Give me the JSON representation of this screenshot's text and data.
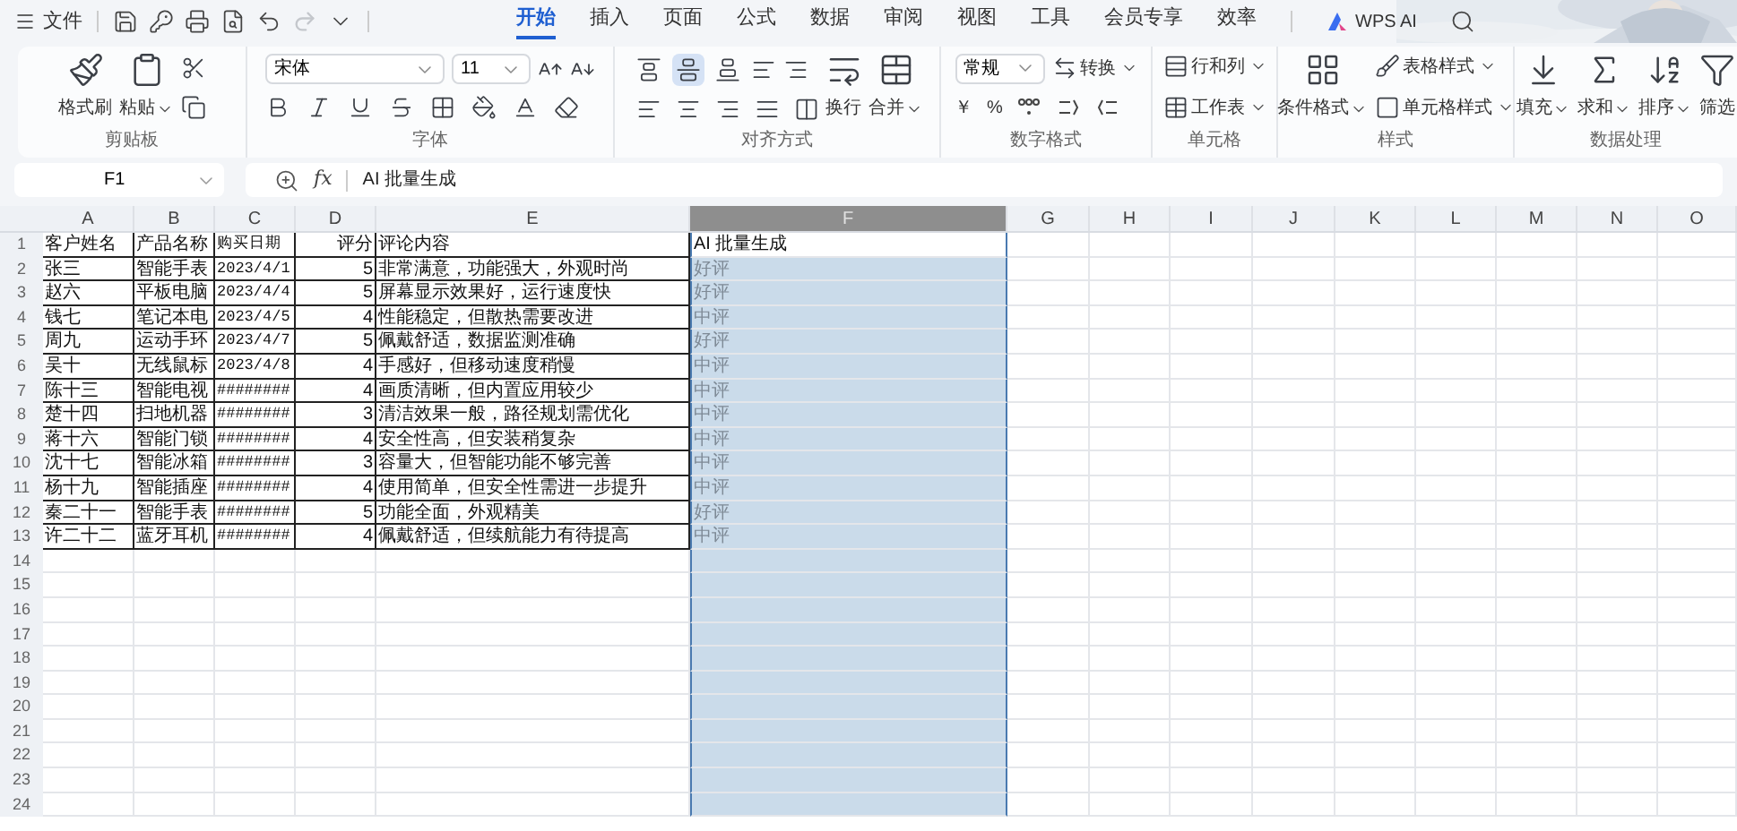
{
  "menu": {
    "file": "文件",
    "redo_disabled": true
  },
  "tabs": [
    {
      "label": "开始",
      "selected": true
    },
    {
      "label": "插入",
      "selected": false
    },
    {
      "label": "页面",
      "selected": false
    },
    {
      "label": "公式",
      "selected": false
    },
    {
      "label": "数据",
      "selected": false
    },
    {
      "label": "审阅",
      "selected": false
    },
    {
      "label": "视图",
      "selected": false
    },
    {
      "label": "工具",
      "selected": false
    },
    {
      "label": "会员专享",
      "selected": false
    },
    {
      "label": "效率",
      "selected": false
    }
  ],
  "ai_tab": "WPS AI",
  "ribbon": {
    "clipboard": {
      "label": "剪贴板",
      "format_painter": "格式刷",
      "paste": "粘贴"
    },
    "font": {
      "label": "字体",
      "font_name": "宋体",
      "font_size": "11"
    },
    "alignment": {
      "label": "对齐方式",
      "wrap": "换行",
      "merge": "合并",
      "vertical_align": [
        {
          "selected": false
        },
        {
          "selected": true
        },
        {
          "selected": false
        }
      ]
    },
    "number_format": {
      "label": "数字格式",
      "format": "常规",
      "convert": "转换",
      "currency": "￥",
      "percent": "%"
    },
    "cells": {
      "label": "单元格",
      "rows_cols": "行和列",
      "worksheet": "工作表"
    },
    "styles": {
      "label": "样式",
      "conditional": "条件格式",
      "table_style": "表格样式",
      "cell_style": "单元格样式"
    },
    "data": {
      "label": "数据处理",
      "fill": "填充",
      "sum": "求和",
      "sort": "排序",
      "filter": "筛选"
    }
  },
  "formula_bar": {
    "name_box": "F1",
    "fx": "fx",
    "formula": "AI 批量生成"
  },
  "columns": [
    {
      "label": "A",
      "selected": false,
      "numeric": false
    },
    {
      "label": "B",
      "selected": false,
      "numeric": false
    },
    {
      "label": "C",
      "selected": false,
      "numeric": false
    },
    {
      "label": "D",
      "selected": false,
      "numeric": true
    },
    {
      "label": "E",
      "selected": false,
      "numeric": false
    },
    {
      "label": "F",
      "selected": true,
      "numeric": false
    },
    {
      "label": "G",
      "selected": false,
      "numeric": false
    },
    {
      "label": "H",
      "selected": false,
      "numeric": false
    },
    {
      "label": "I",
      "selected": false,
      "numeric": false
    },
    {
      "label": "J",
      "selected": false,
      "numeric": false
    },
    {
      "label": "K",
      "selected": false,
      "numeric": false
    },
    {
      "label": "L",
      "selected": false,
      "numeric": false
    },
    {
      "label": "M",
      "selected": false,
      "numeric": false
    },
    {
      "label": "N",
      "selected": false,
      "numeric": false
    },
    {
      "label": "O",
      "selected": false,
      "numeric": false
    }
  ],
  "row_numbers": [
    "1",
    "2",
    "3",
    "4",
    "5",
    "6",
    "7",
    "8",
    "9",
    "10",
    "11",
    "12",
    "13",
    "14",
    "15",
    "16",
    "17",
    "18",
    "19",
    "20",
    "21",
    "22",
    "23",
    "24"
  ],
  "rows": [
    [
      "客户姓名",
      "产品名称",
      "购买日期",
      "评分",
      "评论内容",
      "AI 批量生成"
    ],
    [
      "张三",
      "智能手表",
      "2023/4/1",
      "5",
      "非常满意，功能强大，外观时尚",
      "好评"
    ],
    [
      "赵六",
      "平板电脑",
      "2023/4/4",
      "5",
      "屏幕显示效果好，运行速度快",
      "好评"
    ],
    [
      "钱七",
      "笔记本电",
      "2023/4/5",
      "4",
      "性能稳定，但散热需要改进",
      "中评"
    ],
    [
      "周九",
      "运动手环",
      "2023/4/7",
      "5",
      "佩戴舒适，数据监测准确",
      "好评"
    ],
    [
      "吴十",
      "无线鼠标",
      "2023/4/8",
      "4",
      "手感好，但移动速度稍慢",
      "中评"
    ],
    [
      "陈十三",
      "智能电视",
      "########",
      "4",
      "画质清晰，但内置应用较少",
      "中评"
    ],
    [
      "楚十四",
      "扫地机器",
      "########",
      "3",
      "清洁效果一般，路径规划需优化",
      "中评"
    ],
    [
      "蒋十六",
      "智能门锁",
      "########",
      "4",
      "安全性高，但安装稍复杂",
      "中评"
    ],
    [
      "沈十七",
      "智能冰箱",
      "########",
      "3",
      "容量大，但智能功能不够完善",
      "中评"
    ],
    [
      "杨十九",
      "智能插座",
      "########",
      "4",
      "使用简单，但安全性需进一步提升",
      "中评"
    ],
    [
      "秦二十一",
      "智能手表",
      "########",
      "5",
      "功能全面，外观精美",
      "好评"
    ],
    [
      "许二十二",
      "蓝牙耳机",
      "########",
      "4",
      "佩戴舒适，但续航能力有待提高",
      "中评"
    ]
  ]
}
